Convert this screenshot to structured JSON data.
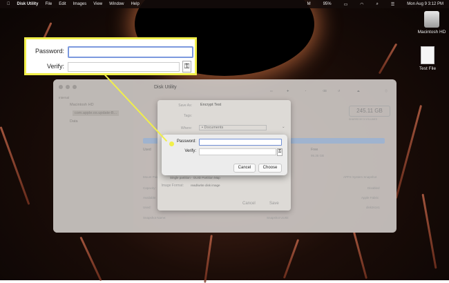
{
  "menubar": {
    "app": "Disk Utility",
    "items": [
      "File",
      "Edit",
      "Images",
      "View",
      "Window",
      "Help"
    ],
    "battery": "95%",
    "datetime": "Mon Aug 9  3:12 PM"
  },
  "desktop": {
    "icons": [
      {
        "label": "Macintosh HD"
      },
      {
        "label": "Test File"
      }
    ]
  },
  "window": {
    "title": "Disk Utility",
    "sidebar": {
      "section": "Internal",
      "items": [
        "Macintosh HD",
        "com.apple.os.update-B...",
        "Data"
      ]
    },
    "capacity": "245.11 GB",
    "shared_label": "SHARED BY 5 VOLUMES",
    "used_label": "Used",
    "free_label": "Free",
    "free_value": "95.35 GB",
    "rows": [
      {
        "label": "Mount Point:",
        "value": "APFS System Snapshot"
      },
      {
        "label": "Capacity:",
        "value": "Disabled"
      },
      {
        "label": "Available:",
        "value": "Apple Fabric"
      },
      {
        "label": "Used:",
        "value": "disk3s1s1"
      },
      {
        "label": "Snapshot Name:",
        "value": "Snapshot UUID:"
      }
    ]
  },
  "sheet": {
    "save_as_label": "Save As:",
    "save_as_value": "Encrypt Test",
    "tags_label": "Tags:",
    "where_label": "Where:",
    "where_value": "Documents",
    "partitions_value": "Single partition - GUID Partition Map",
    "image_format_label": "Image Format:",
    "image_format_value": "read/write disk image",
    "cancel": "Cancel",
    "save": "Save"
  },
  "dialog": {
    "password_label": "Password:",
    "verify_label": "Verify:",
    "cancel": "Cancel",
    "choose": "Choose"
  },
  "callout": {
    "password_label": "Password:",
    "verify_label": "Verify:"
  }
}
